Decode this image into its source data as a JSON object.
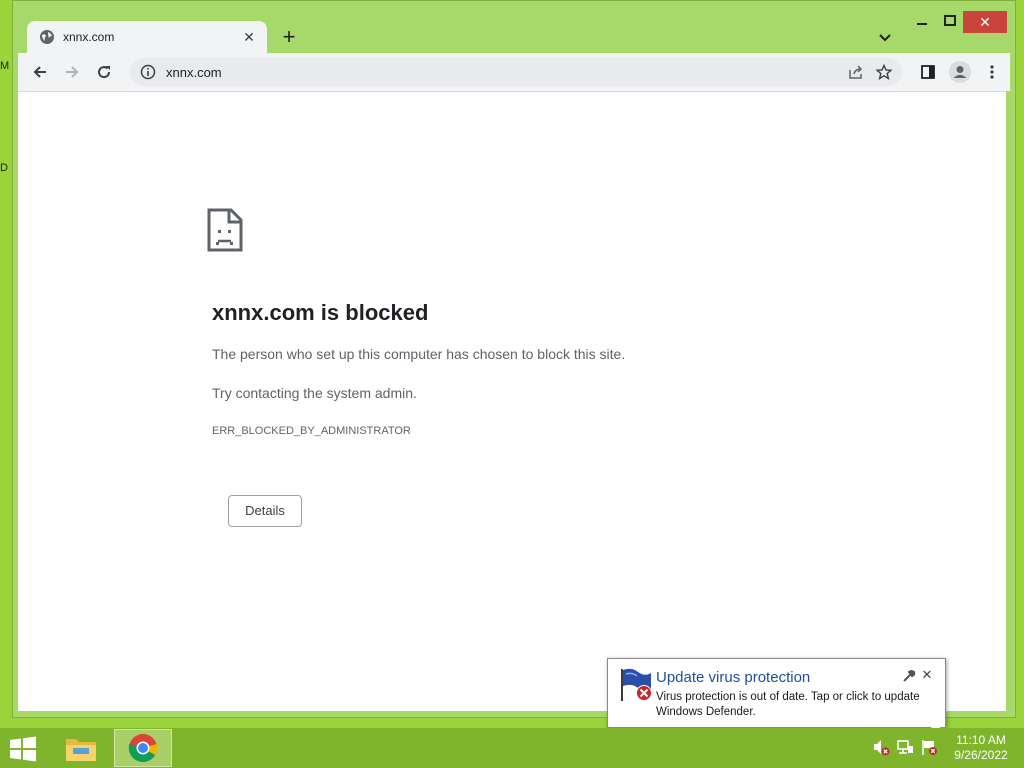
{
  "desktop": {
    "edge_text_a": "M",
    "edge_text_b": "D"
  },
  "browser": {
    "tab_title": "xnnx.com",
    "new_tab_label": "+",
    "tab_close_label": "✕",
    "window_close_label": "✕",
    "address": "xnnx.com"
  },
  "page": {
    "title": "xnnx.com is blocked",
    "description": "The person who set up this computer has chosen to block this site.",
    "hint": "Try contacting the system admin.",
    "error_code": "ERR_BLOCKED_BY_ADMINISTRATOR",
    "details_label": "Details"
  },
  "notification": {
    "title": "Update virus protection",
    "body": "Virus protection is out of date. Tap or click to update Windows Defender.",
    "close_label": "✕"
  },
  "taskbar": {
    "time": "11:10 AM",
    "date": "9/26/2022",
    "apps": [
      "file-explorer",
      "chrome"
    ]
  },
  "colors": {
    "desktop": "#9bd33a",
    "window_frame": "#a6d96a",
    "taskbar": "#7fb42c",
    "close_button": "#c7453a",
    "notification_title": "#1f4e9c"
  }
}
